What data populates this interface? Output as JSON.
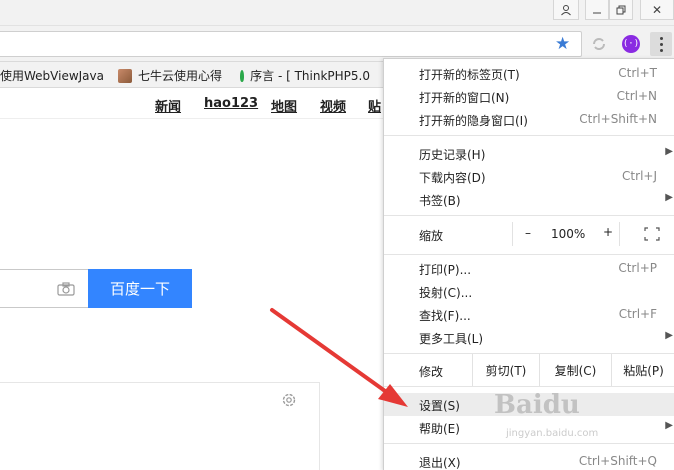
{
  "bookmarks": [
    {
      "label": "使用WebViewJavas"
    },
    {
      "label": "七牛云使用心得"
    },
    {
      "label": "序言 - [ ThinkPHP5.0"
    }
  ],
  "nav": [
    "新闻",
    "hao123",
    "地图",
    "视频",
    "贴"
  ],
  "search": {
    "button_label": "百度一下"
  },
  "extension": {
    "purple_label": "(·)"
  },
  "menu": {
    "items": [
      {
        "label": "打开新的标签页(T)",
        "shortcut": "Ctrl+T"
      },
      {
        "label": "打开新的窗口(N)",
        "shortcut": "Ctrl+N"
      },
      {
        "label": "打开新的隐身窗口(I)",
        "shortcut": "Ctrl+Shift+N"
      },
      {
        "label": "历史记录(H)",
        "shortcut": ""
      },
      {
        "label": "下载内容(D)",
        "shortcut": "Ctrl+J"
      },
      {
        "label": "书签(B)",
        "shortcut": ""
      },
      {
        "label": "打印(P)...",
        "shortcut": "Ctrl+P"
      },
      {
        "label": "投射(C)...",
        "shortcut": ""
      },
      {
        "label": "查找(F)...",
        "shortcut": "Ctrl+F"
      },
      {
        "label": "更多工具(L)",
        "shortcut": ""
      },
      {
        "label": "设置(S)",
        "shortcut": ""
      },
      {
        "label": "帮助(E)",
        "shortcut": ""
      },
      {
        "label": "退出(X)",
        "shortcut": "Ctrl+Shift+Q"
      }
    ],
    "zoom": {
      "label": "缩放",
      "minus": "–",
      "value": "100%",
      "plus": "+"
    },
    "edit": {
      "label": "修改",
      "cut": "剪切(T)",
      "copy": "复制(C)",
      "paste": "粘贴(P)"
    }
  },
  "icons": {
    "star": "★",
    "close": "✕"
  },
  "colors": {
    "search_button": "#3385ff",
    "arrow": "#e53935",
    "star": "#3a7bd5"
  },
  "watermark": {
    "text": "Baidu",
    "sub": "jingyan.baidu.com"
  }
}
